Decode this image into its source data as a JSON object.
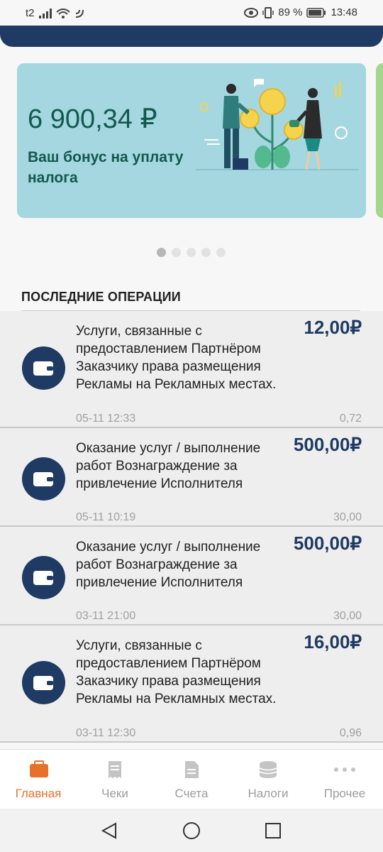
{
  "status_bar": {
    "carrier": "t2",
    "battery": "89 %",
    "time": "13:48"
  },
  "banner": {
    "amount": "6 900,34 ₽",
    "text": "Ваш бонус на уплату налога"
  },
  "carousel": {
    "pages": 5,
    "active_index": 0
  },
  "section": {
    "title": "ПОСЛЕДНИЕ ОПЕРАЦИИ"
  },
  "operations": [
    {
      "description": "Услуги, связанные с предоставлением Партнёром Заказчику права размещения Рекламы на Рекламных местах.",
      "amount": "12,00₽",
      "date": "05-11 12:33",
      "fee": "0,72"
    },
    {
      "description": "Оказание услуг / выполнение работ Вознаграждение за привлечение Исполнителя",
      "amount": "500,00₽",
      "date": "05-11 10:19",
      "fee": "30,00"
    },
    {
      "description": "Оказание услуг / выполнение работ Вознаграждение за привлечение Исполнителя",
      "amount": "500,00₽",
      "date": "03-11 21:00",
      "fee": "30,00"
    },
    {
      "description": "Услуги, связанные с предоставлением Партнёром Заказчику права размещения Рекламы на Рекламных местах.",
      "amount": "16,00₽",
      "date": "03-11 12:30",
      "fee": "0,96"
    }
  ],
  "bottom_nav": [
    {
      "label": "Главная",
      "icon": "briefcase-icon",
      "active": true
    },
    {
      "label": "Чеки",
      "icon": "receipt-icon",
      "active": false
    },
    {
      "label": "Счета",
      "icon": "document-icon",
      "active": false
    },
    {
      "label": "Налоги",
      "icon": "coins-icon",
      "active": false
    },
    {
      "label": "Прочее",
      "icon": "more-icon",
      "active": false
    }
  ],
  "colors": {
    "primary": "#1f3a63",
    "accent": "#e8702a",
    "banner_bg": "#a4d7df",
    "banner_text": "#14584f"
  }
}
